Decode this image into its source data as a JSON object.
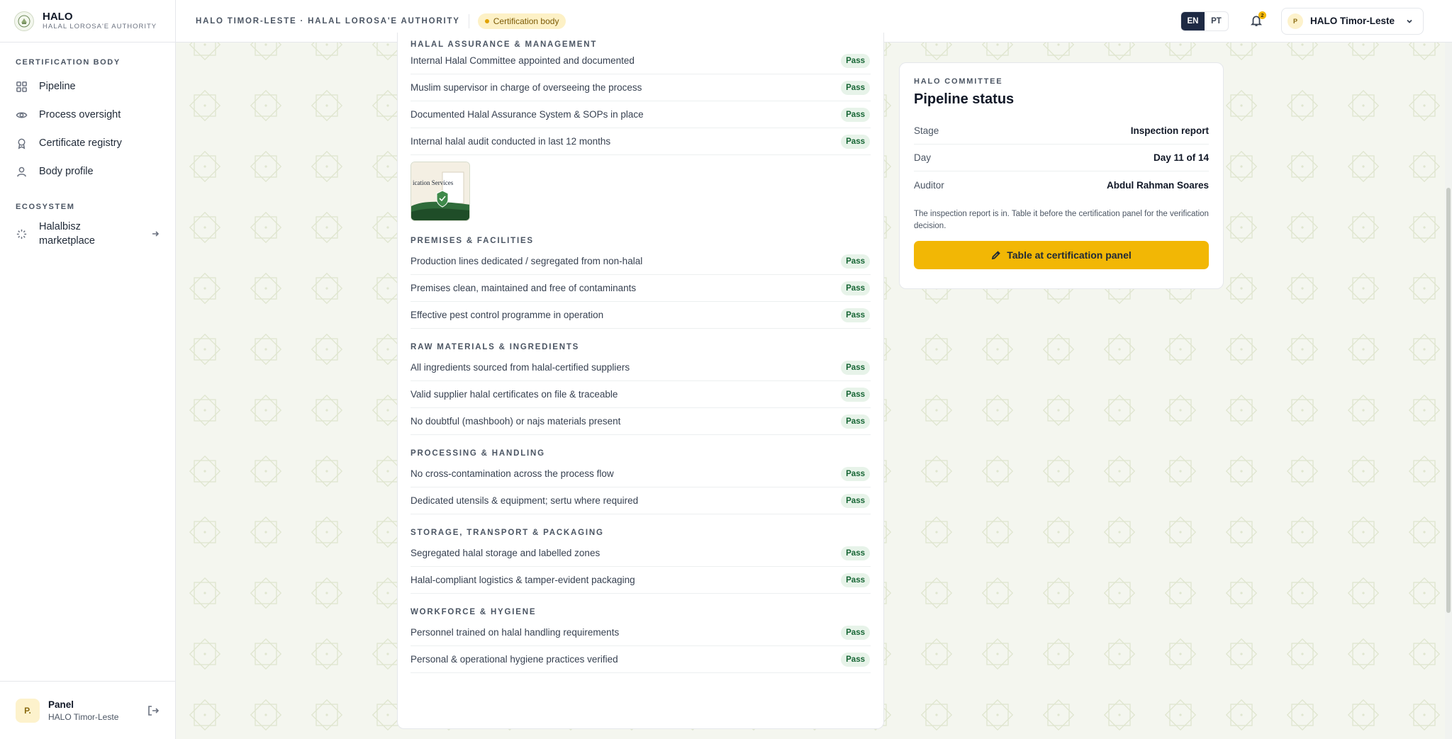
{
  "brand": {
    "name": "HALO",
    "subtitle": "HALAL LOROSA'E AUTHORITY",
    "logo_icon": "halo-seal-icon"
  },
  "sidebar": {
    "section_certification": "CERTIFICATION BODY",
    "items": [
      {
        "label": "Pipeline",
        "icon": "grid-icon"
      },
      {
        "label": "Process oversight",
        "icon": "eye-icon"
      },
      {
        "label": "Certificate registry",
        "icon": "award-icon"
      },
      {
        "label": "Body profile",
        "icon": "user-icon"
      }
    ],
    "section_ecosystem": "ECOSYSTEM",
    "ecosystem_item": {
      "label": "Halalbisz marketplace",
      "icon": "sparkle-icon",
      "trailing_icon": "arrow-right-icon"
    },
    "footer": {
      "avatar": "P.",
      "name": "Panel",
      "org": "HALO Timor-Leste",
      "logout_icon": "logout-icon"
    }
  },
  "topbar": {
    "breadcrumb": "HALO Timor-Leste · Halal Lorosa'e Authority",
    "role_badge": "Certification body",
    "languages": [
      "EN",
      "PT"
    ],
    "active_language": "EN",
    "notifications_count": "2",
    "org_avatar": "P",
    "org_name": "HALO Timor-Leste"
  },
  "checklist": {
    "sections": [
      {
        "title": "Halal assurance & management",
        "items": [
          "Internal Halal Committee appointed and documented",
          "Muslim supervisor in charge of overseeing the process",
          "Documented Halal Assurance System & SOPs in place",
          "Internal halal audit conducted in last 12 months"
        ]
      },
      {
        "title": "Premises & facilities",
        "items": [
          "Production lines dedicated / segregated from non-halal",
          "Premises clean, maintained and free of contaminants",
          "Effective pest control programme in operation"
        ]
      },
      {
        "title": "Raw materials & ingredients",
        "items": [
          "All ingredients sourced from halal-certified suppliers",
          "Valid supplier halal certificates on file & traceable",
          "No doubtful (mashbooh) or najs materials present"
        ]
      },
      {
        "title": "Processing & handling",
        "items": [
          "No cross-contamination across the process flow",
          "Dedicated utensils & equipment; sertu where required"
        ]
      },
      {
        "title": "Storage, transport & packaging",
        "items": [
          "Segregated halal storage and labelled zones",
          "Halal-compliant logistics & tamper-evident packaging"
        ]
      },
      {
        "title": "Workforce & hygiene",
        "items": [
          "Personnel trained on halal handling requirements",
          "Personal & operational hygiene practices verified"
        ]
      }
    ],
    "status_label": "Pass",
    "attachment_caption": "ication Services"
  },
  "pipeline": {
    "eyebrow": "HALO Committee",
    "title": "Pipeline status",
    "rows": [
      {
        "key": "Stage",
        "value": "Inspection report"
      },
      {
        "key": "Day",
        "value": "Day 11 of 14"
      },
      {
        "key": "Auditor",
        "value": "Abdul Rahman Soares"
      }
    ],
    "note": "The inspection report is in. Table it before the certification panel for the verification decision.",
    "action_label": "Table at certification panel",
    "action_icon": "pencil-icon"
  },
  "colors": {
    "accent": "#f2b705",
    "pass_bg": "#e7f3e9",
    "pass_text": "#166534",
    "nav_active": "#1e2a44"
  }
}
